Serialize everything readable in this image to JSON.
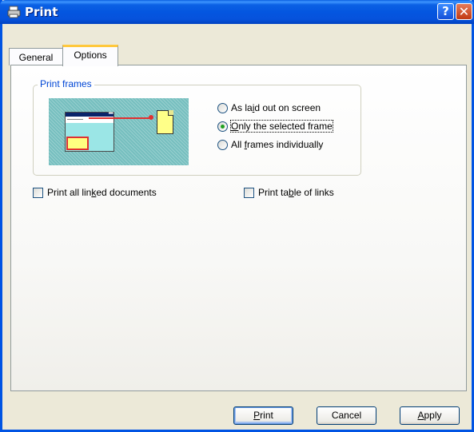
{
  "window": {
    "title": "Print",
    "help_label": "?",
    "close_label": "✕"
  },
  "tabs": [
    {
      "label": "General",
      "selected": false
    },
    {
      "label": "Options",
      "selected": true
    }
  ],
  "print_frames": {
    "group_label": "Print frames",
    "options": [
      {
        "label_before": "As la",
        "mnemonic": "i",
        "label_after": "d out on screen",
        "selected": false
      },
      {
        "label_before": "",
        "mnemonic": "O",
        "label_after": "nly the selected frame",
        "selected": true
      },
      {
        "label_before": "All ",
        "mnemonic": "f",
        "label_after": "rames individually",
        "selected": false
      }
    ]
  },
  "checkboxes": {
    "linked": {
      "label_before": "Print all lin",
      "mnemonic": "k",
      "label_after": "ed documents",
      "checked": false
    },
    "table_links": {
      "label_before": "Print ta",
      "mnemonic": "b",
      "label_after": "le of links",
      "checked": false
    }
  },
  "buttons": {
    "print": {
      "mnemonic": "P",
      "label_after": "rint"
    },
    "cancel": {
      "label": "Cancel"
    },
    "apply": {
      "mnemonic": "A",
      "label_after": "pply"
    }
  },
  "colors": {
    "title_bar": "#0054E3",
    "dialog_bg": "#ECE9D8",
    "group_label": "#0046D5",
    "tab_highlight": "#FFC83C",
    "radio_dot": "#21A121"
  },
  "icons": [
    "printer-icon",
    "help-icon",
    "close-icon",
    "frame-layout-preview-icon"
  ]
}
